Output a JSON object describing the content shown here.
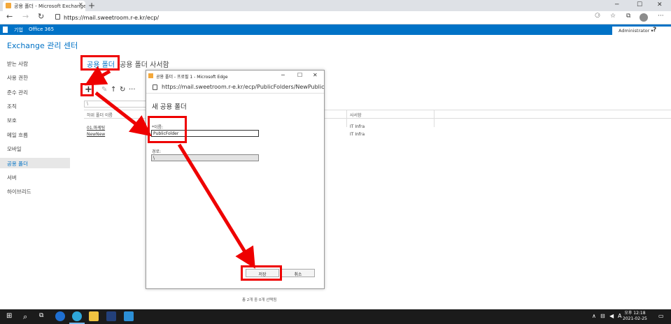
{
  "browser": {
    "tab_title": "공용 폴더 - Microsoft Exchange",
    "url": "https://mail.sweetroom.r-e.kr/ecp/"
  },
  "o365": {
    "org_label": "기업",
    "brand": "Office 365",
    "user": "Administrator ▾",
    "help": "?"
  },
  "ecp": {
    "title": "Exchange 관리 센터",
    "nav": [
      "받는 사람",
      "사용 권한",
      "준수 관리",
      "조직",
      "보호",
      "메일 흐름",
      "모바일",
      "공용 폴더",
      "서버",
      "하이브리드"
    ],
    "selected_nav_index": 7,
    "tabs": [
      "공용 폴더",
      "공용 폴더 사서함"
    ],
    "search_placeholder": "\\",
    "columns": [
      "하위 폴더 이름",
      "사서함"
    ],
    "rows": [
      {
        "name": "01.마케팅",
        "mailbox": "IT Infra"
      },
      {
        "name": "NewNew",
        "mailbox": "IT Infra"
      }
    ],
    "status": "총 2개 중 0개 선택됨"
  },
  "dialog": {
    "title": "공용 폴더 - 프로필 1 - Microsoft Edge",
    "url": "https://mail.sweetroom.r-e.kr/ecp/PublicFolders/NewPublicFo...",
    "heading": "새 공용 폴더",
    "name_label": "*이름:",
    "name_value": "PublicFolder",
    "path_label": "경로:",
    "path_value": "\\",
    "save_label": "저장",
    "cancel_label": "취소"
  },
  "taskbar": {
    "time": "오후 12:18",
    "date": "2021-02-25",
    "ime": "A"
  },
  "colors": {
    "o365_bar": "#0072c6",
    "annotation": "#ee0000",
    "taskbar": "#1b1b1b"
  }
}
